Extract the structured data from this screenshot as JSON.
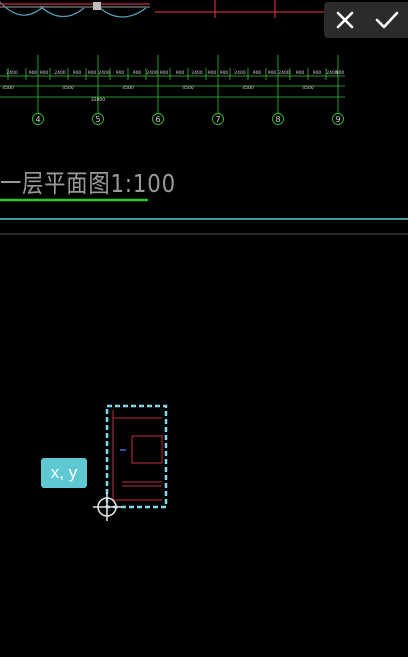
{
  "toolbar": {
    "close_icon": "close-icon",
    "confirm_icon": "check-icon"
  },
  "drawing": {
    "title": "一层平面图1:100",
    "dim_row1": [
      "2400",
      "900",
      "900",
      "2400",
      "900",
      "900",
      "2400",
      "900",
      "900",
      "2400",
      "900",
      "900",
      "2400",
      "900",
      "900",
      "2400",
      "900",
      "900",
      "2400",
      "900",
      "900",
      "2400",
      "900"
    ],
    "dim_row2": [
      "4500",
      "4500",
      "4500",
      "4500",
      "4500",
      "4500"
    ],
    "dim_total": "32800",
    "axes": [
      "4",
      "5",
      "6",
      "7",
      "8",
      "9"
    ]
  },
  "coord_button": {
    "label": "x, y"
  },
  "colors": {
    "background": "#000000",
    "accent_cyan": "#5fc9d3",
    "green_line": "#2fc42f",
    "red_line": "#c0303a",
    "selection": "#8ad3ee"
  }
}
